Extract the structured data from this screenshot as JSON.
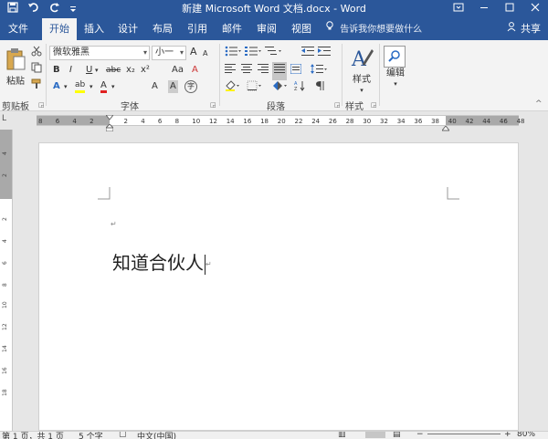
{
  "titlebar": {
    "title": "新建 Microsoft Word 文档.docx - Word",
    "qat": [
      "save-icon",
      "undo-icon",
      "redo-icon",
      "customize-icon"
    ],
    "window_buttons": [
      "ribbon-display-icon",
      "minimize-icon",
      "maximize-icon",
      "close-icon"
    ]
  },
  "tabs": {
    "items": [
      {
        "label": "文件"
      },
      {
        "label": "开始",
        "active": true
      },
      {
        "label": "插入"
      },
      {
        "label": "设计"
      },
      {
        "label": "布局"
      },
      {
        "label": "引用"
      },
      {
        "label": "邮件"
      },
      {
        "label": "审阅"
      },
      {
        "label": "视图"
      }
    ],
    "tell_me": "告诉我你想要做什么",
    "share": "共享"
  },
  "ribbon": {
    "clipboard": {
      "paste_label": "粘贴",
      "group_label": "剪贴板"
    },
    "font": {
      "font_name": "微软雅黑",
      "font_size": "小一",
      "group_label": "字体",
      "bold": "B",
      "italic": "I",
      "underline": "U",
      "strike": "abc",
      "subscript": "x₂",
      "superscript": "x²",
      "grow": "A",
      "shrink": "A",
      "case": "Aa",
      "clear": "A",
      "text_effects": "A",
      "highlight": "ab",
      "font_color": "A",
      "char_shading": "A",
      "enclose": "字"
    },
    "paragraph": {
      "group_label": "段落"
    },
    "styles": {
      "label": "样式",
      "group_label": "样式"
    },
    "editing": {
      "label": "编辑"
    }
  },
  "ruler": {
    "ticks": [
      "8",
      "6",
      "4",
      "2",
      "",
      "2",
      "4",
      "6",
      "8",
      "10",
      "12",
      "14",
      "16",
      "18",
      "20",
      "22",
      "24",
      "26",
      "28",
      "30",
      "32",
      "34",
      "36",
      "38",
      "40",
      "42",
      "44",
      "46",
      "48"
    ]
  },
  "vruler": {
    "ticks": [
      "4",
      "2",
      "",
      "2",
      "4",
      "6",
      "8",
      "10",
      "12",
      "14",
      "16",
      "18"
    ]
  },
  "document": {
    "text": "知道合伙人"
  },
  "status": {
    "page": "第 1 页，共 1 页",
    "words": "5 个字",
    "language": "中文(中国)",
    "zoom": "80%"
  },
  "colors": {
    "brand": "#2b579a",
    "highlight": "#ffff00",
    "font_color": "#e02020"
  }
}
